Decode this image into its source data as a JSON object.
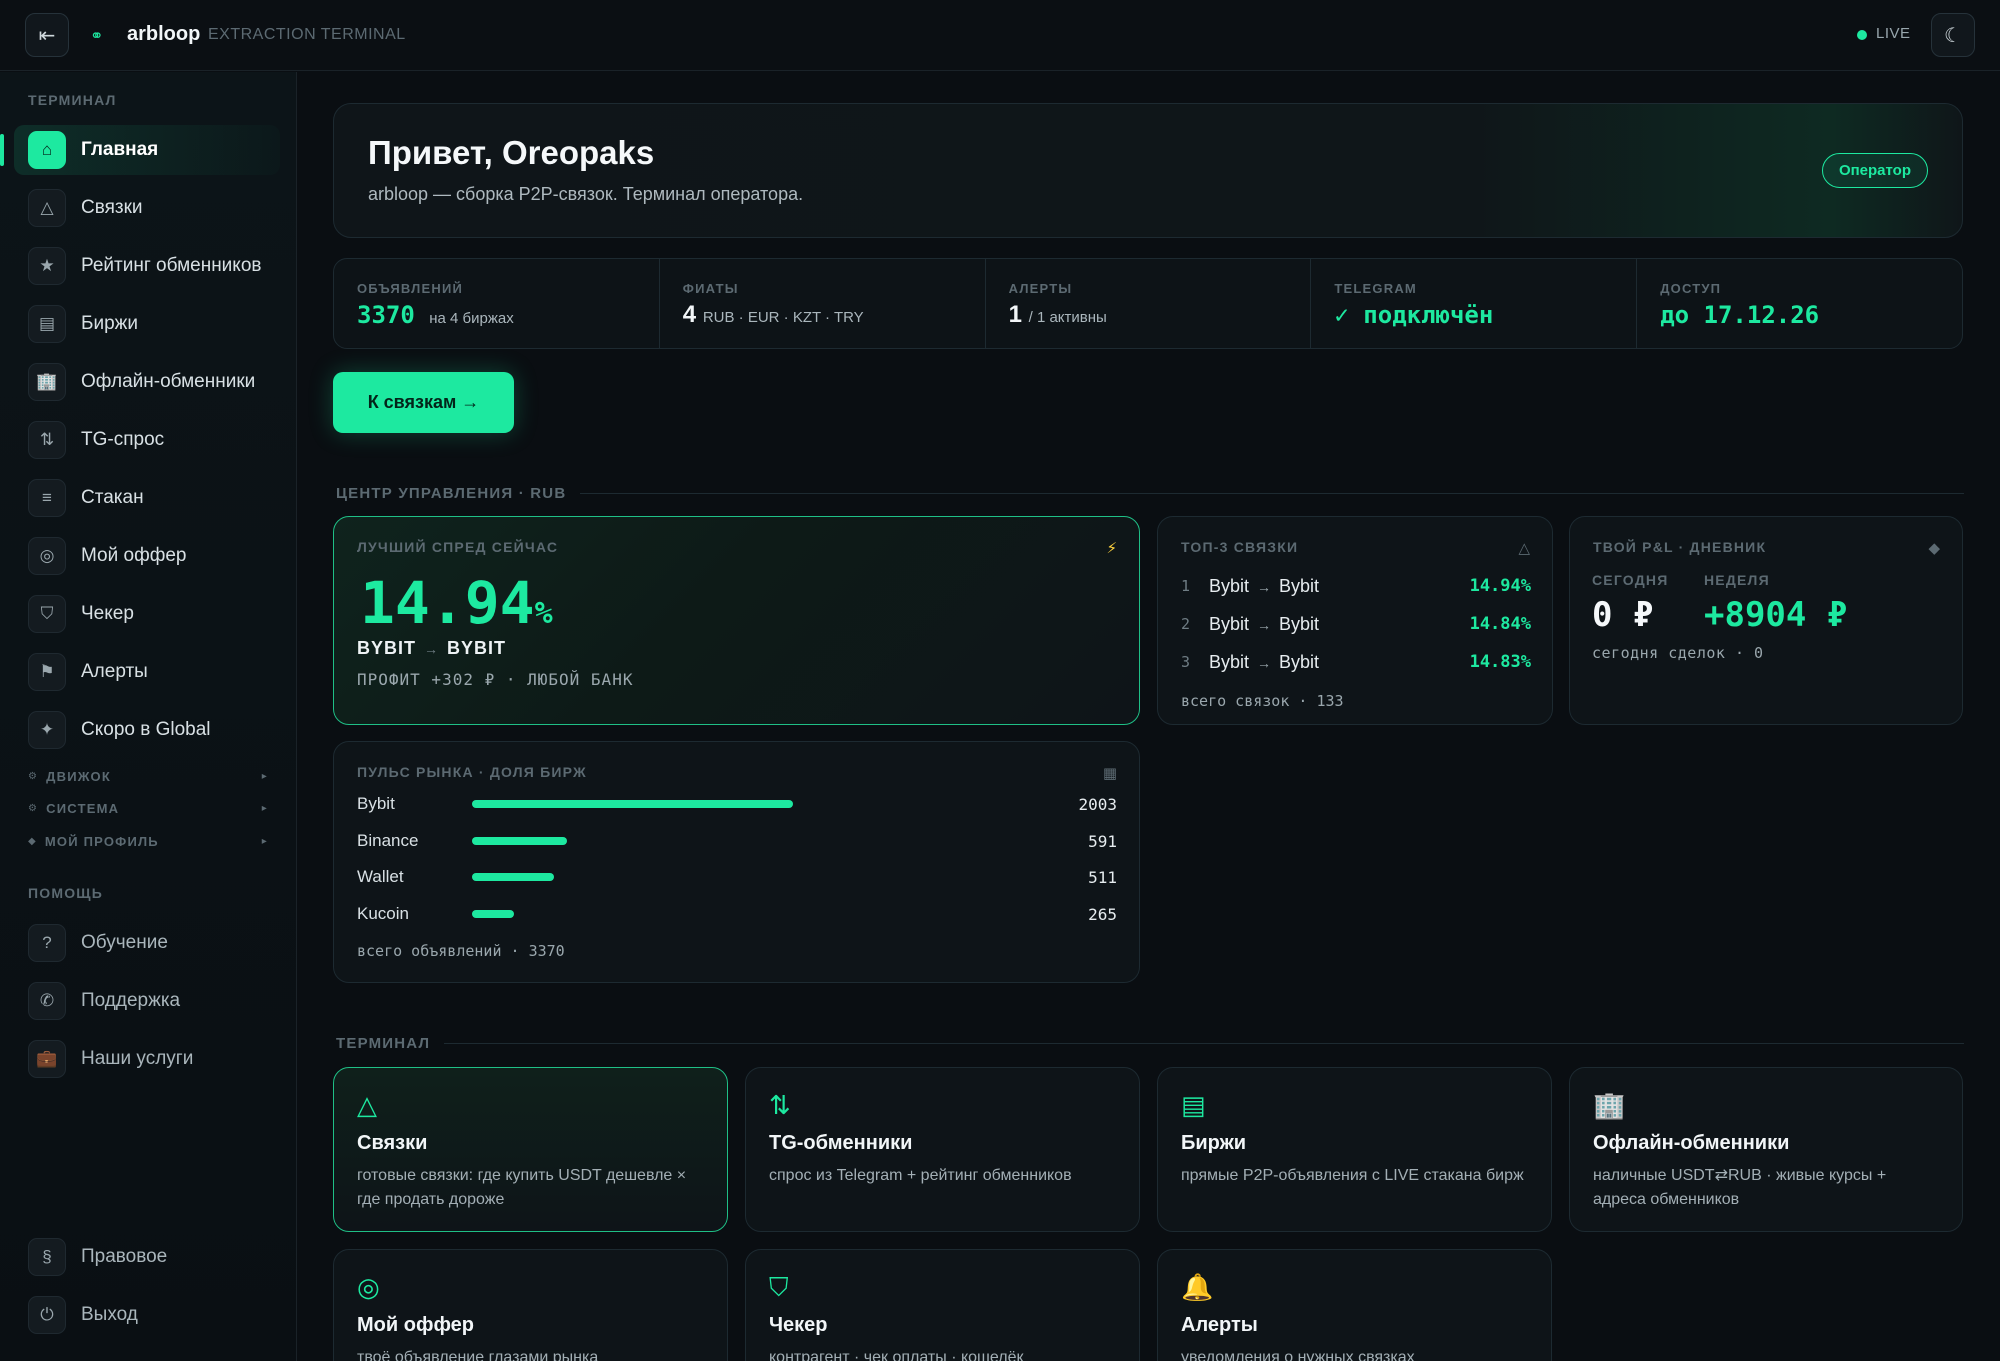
{
  "topbar": {
    "brand": "arbloop",
    "subtitle": "EXTRACTION TERMINAL",
    "live": "LIVE",
    "collapse_icon": "collapse-icon",
    "theme_icon": "moon-icon"
  },
  "sidebar": {
    "section_terminal": "ТЕРМИНАЛ",
    "items": [
      {
        "label": "Главная",
        "icon": "home-icon",
        "glyph": "⌂"
      },
      {
        "label": "Связки",
        "icon": "triangle-icon",
        "glyph": "△"
      },
      {
        "label": "Рейтинг обменников",
        "icon": "star-icon",
        "glyph": "★"
      },
      {
        "label": "Биржи",
        "icon": "list-icon",
        "glyph": "▤"
      },
      {
        "label": "Офлайн-обменники",
        "icon": "building-icon",
        "glyph": "🏢"
      },
      {
        "label": "TG-спрос",
        "icon": "swap-icon",
        "glyph": "⇅"
      },
      {
        "label": "Стакан",
        "icon": "lines-icon",
        "glyph": "≡"
      },
      {
        "label": "Мой оффер",
        "icon": "target-icon",
        "glyph": "◎"
      },
      {
        "label": "Чекер",
        "icon": "shield-icon",
        "glyph": "⛉"
      },
      {
        "label": "Алерты",
        "icon": "flag-icon",
        "glyph": "⚑"
      },
      {
        "label": "Скоро в Global",
        "icon": "sparkle-icon",
        "glyph": "✦"
      }
    ],
    "groups": [
      {
        "label": "ДВИЖОК",
        "glyph": "⚙"
      },
      {
        "label": "СИСТЕМА",
        "glyph": "⚙"
      },
      {
        "label": "МОЙ ПРОФИЛЬ",
        "glyph": "◆"
      }
    ],
    "section_help": "ПОМОЩЬ",
    "help_items": [
      {
        "label": "Обучение",
        "icon": "question-icon",
        "glyph": "?"
      },
      {
        "label": "Поддержка",
        "icon": "phone-icon",
        "glyph": "✆"
      },
      {
        "label": "Наши услуги",
        "icon": "briefcase-icon",
        "glyph": "💼"
      }
    ],
    "bottom_items": [
      {
        "label": "Правовое",
        "icon": "section-icon",
        "glyph": "§"
      },
      {
        "label": "Выход",
        "icon": "power-icon",
        "glyph": "⏻"
      }
    ]
  },
  "hero": {
    "title": "Привет, Oreopaks",
    "subtitle": "arbloop — сборка P2P-связок. Терминал оператора.",
    "role": "Оператор"
  },
  "stats": [
    {
      "label": "ОБЪЯВЛЕНИЙ",
      "value": "3370",
      "note": "на 4 биржах"
    },
    {
      "label": "ФИАТЫ",
      "value": "4",
      "note": "RUB · EUR · KZT · TRY"
    },
    {
      "label": "АЛЕРТЫ",
      "value": "1",
      "note": "/ 1 активны"
    },
    {
      "label": "TELEGRAM",
      "value": "✓ подключён",
      "note": ""
    },
    {
      "label": "ДОСТУП",
      "value": "до 17.12.26",
      "note": ""
    }
  ],
  "cta_label": "К связкам →",
  "control_center_title": "ЦЕНТР УПРАВЛЕНИЯ · RUB",
  "best_spread": {
    "label": "ЛУЧШИЙ СПРЕД СЕЙЧАС",
    "value": "14.94",
    "unit": "%",
    "from": "BYBIT",
    "arrow": "→",
    "to": "BYBIT",
    "profit": "ПРОФИТ +302 ₽ · ЛЮБОЙ БАНК",
    "corner_icon": "⚡"
  },
  "top3": {
    "label": "ТОП-3 СВЯЗКИ",
    "corner_icon": "△",
    "rows": [
      {
        "n": "1",
        "from": "Bybit",
        "to": "Bybit",
        "value": "14.94%"
      },
      {
        "n": "2",
        "from": "Bybit",
        "to": "Bybit",
        "value": "14.84%"
      },
      {
        "n": "3",
        "from": "Bybit",
        "to": "Bybit",
        "value": "14.83%"
      }
    ],
    "arrow": "→",
    "total": "всего связок · 133"
  },
  "pnl": {
    "label": "ТВОЙ P&L · ДНЕВНИК",
    "corner_icon": "◆",
    "today_label": "СЕГОДНЯ",
    "today_value": "0 ₽",
    "week_label": "НЕДЕЛЯ",
    "week_value": "+8904 ₽",
    "deals": "сегодня сделок · 0"
  },
  "pulse": {
    "label": "ПУЛЬС РЫНКА · ДОЛЯ БИРЖ",
    "corner_icon": "▦",
    "rows": [
      {
        "name": "Bybit",
        "count": "2003",
        "share": 0.5944
      },
      {
        "name": "Binance",
        "count": "591",
        "share": 0.1754
      },
      {
        "name": "Wallet",
        "count": "511",
        "share": 0.1516
      },
      {
        "name": "Kucoin",
        "count": "265",
        "share": 0.0786
      }
    ],
    "total": "всего объявлений · 3370"
  },
  "terminal_title": "ТЕРМИНАЛ",
  "tiles": [
    {
      "title": "Связки",
      "desc": "готовые связки: где купить USDT дешевле × где продать дороже",
      "icon": "triangle-icon",
      "glyph": "△"
    },
    {
      "title": "TG-обменники",
      "desc": "спрос из Telegram + рейтинг обменников",
      "icon": "swap-icon",
      "glyph": "⇅"
    },
    {
      "title": "Биржи",
      "desc": "прямые P2P-объявления с LIVE стакана бирж",
      "icon": "list-icon",
      "glyph": "▤"
    },
    {
      "title": "Офлайн-обменники",
      "desc": "наличные USDT⇄RUB · живые курсы + адреса обменников",
      "icon": "building-icon",
      "glyph": "🏢"
    },
    {
      "title": "Мой оффер",
      "desc": "твоё объявление глазами рынка",
      "icon": "target-icon",
      "glyph": "◎"
    },
    {
      "title": "Чекер",
      "desc": "контрагент · чек оплаты · кошелёк",
      "icon": "shield-icon",
      "glyph": "⛉"
    },
    {
      "title": "Алерты",
      "desc": "уведомления о нужных связках",
      "icon": "bell-icon",
      "glyph": "🔔"
    }
  ],
  "colors": {
    "accent": "#1de9a0",
    "background": "#0a0e12",
    "panel": "#0e1418"
  }
}
